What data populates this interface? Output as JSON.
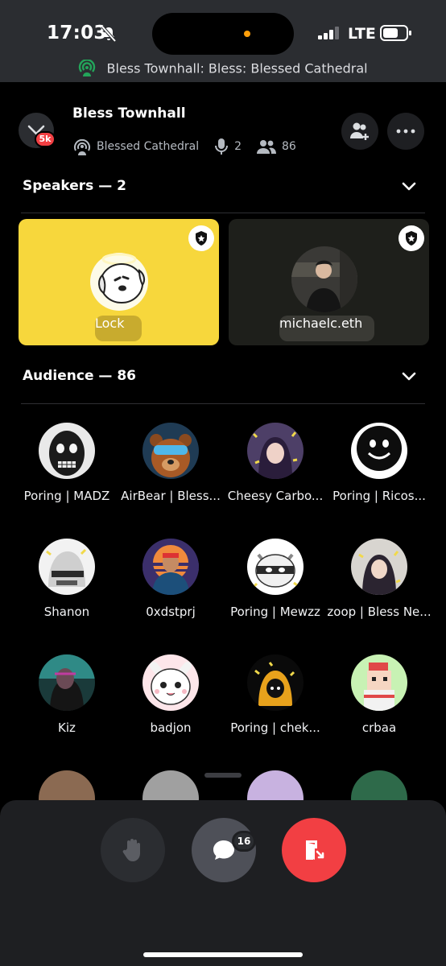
{
  "status_bar": {
    "time": "17:03",
    "carrier": "LTE"
  },
  "live_banner": {
    "text": "Bless Townhall: Bless: Blessed Cathedral"
  },
  "header": {
    "server_badge": "5k",
    "title": "Bless Townhall",
    "stage_name": "Blessed Cathedral",
    "speaker_count": "2",
    "listener_count": "86"
  },
  "speakers_section": {
    "label": "Speakers — 2",
    "speakers": [
      {
        "name": "Lock",
        "card_color": "#f7d73c"
      },
      {
        "name": "michaelc.eth",
        "card_color": "#1e1f1b"
      }
    ]
  },
  "audience_section": {
    "label": "Audience — 86",
    "members": [
      {
        "name": "Poring | MADZ"
      },
      {
        "name": "AirBear | Bless..."
      },
      {
        "name": "Cheesy Carbo..."
      },
      {
        "name": "Poring | Ricos..."
      },
      {
        "name": "Shanon"
      },
      {
        "name": "0xdstprj"
      },
      {
        "name": "Poring | Mewzz"
      },
      {
        "name": "zoop | Bless Ne..."
      },
      {
        "name": "Kiz"
      },
      {
        "name": "badjon"
      },
      {
        "name": "Poring  | chek..."
      },
      {
        "name": "crbaa"
      }
    ]
  },
  "controls": {
    "chat_badge": "16"
  },
  "colors": {
    "accent_red": "#f23f43",
    "banner_green": "#23a55a",
    "background": "#000000",
    "panel": "#1e1f22"
  }
}
